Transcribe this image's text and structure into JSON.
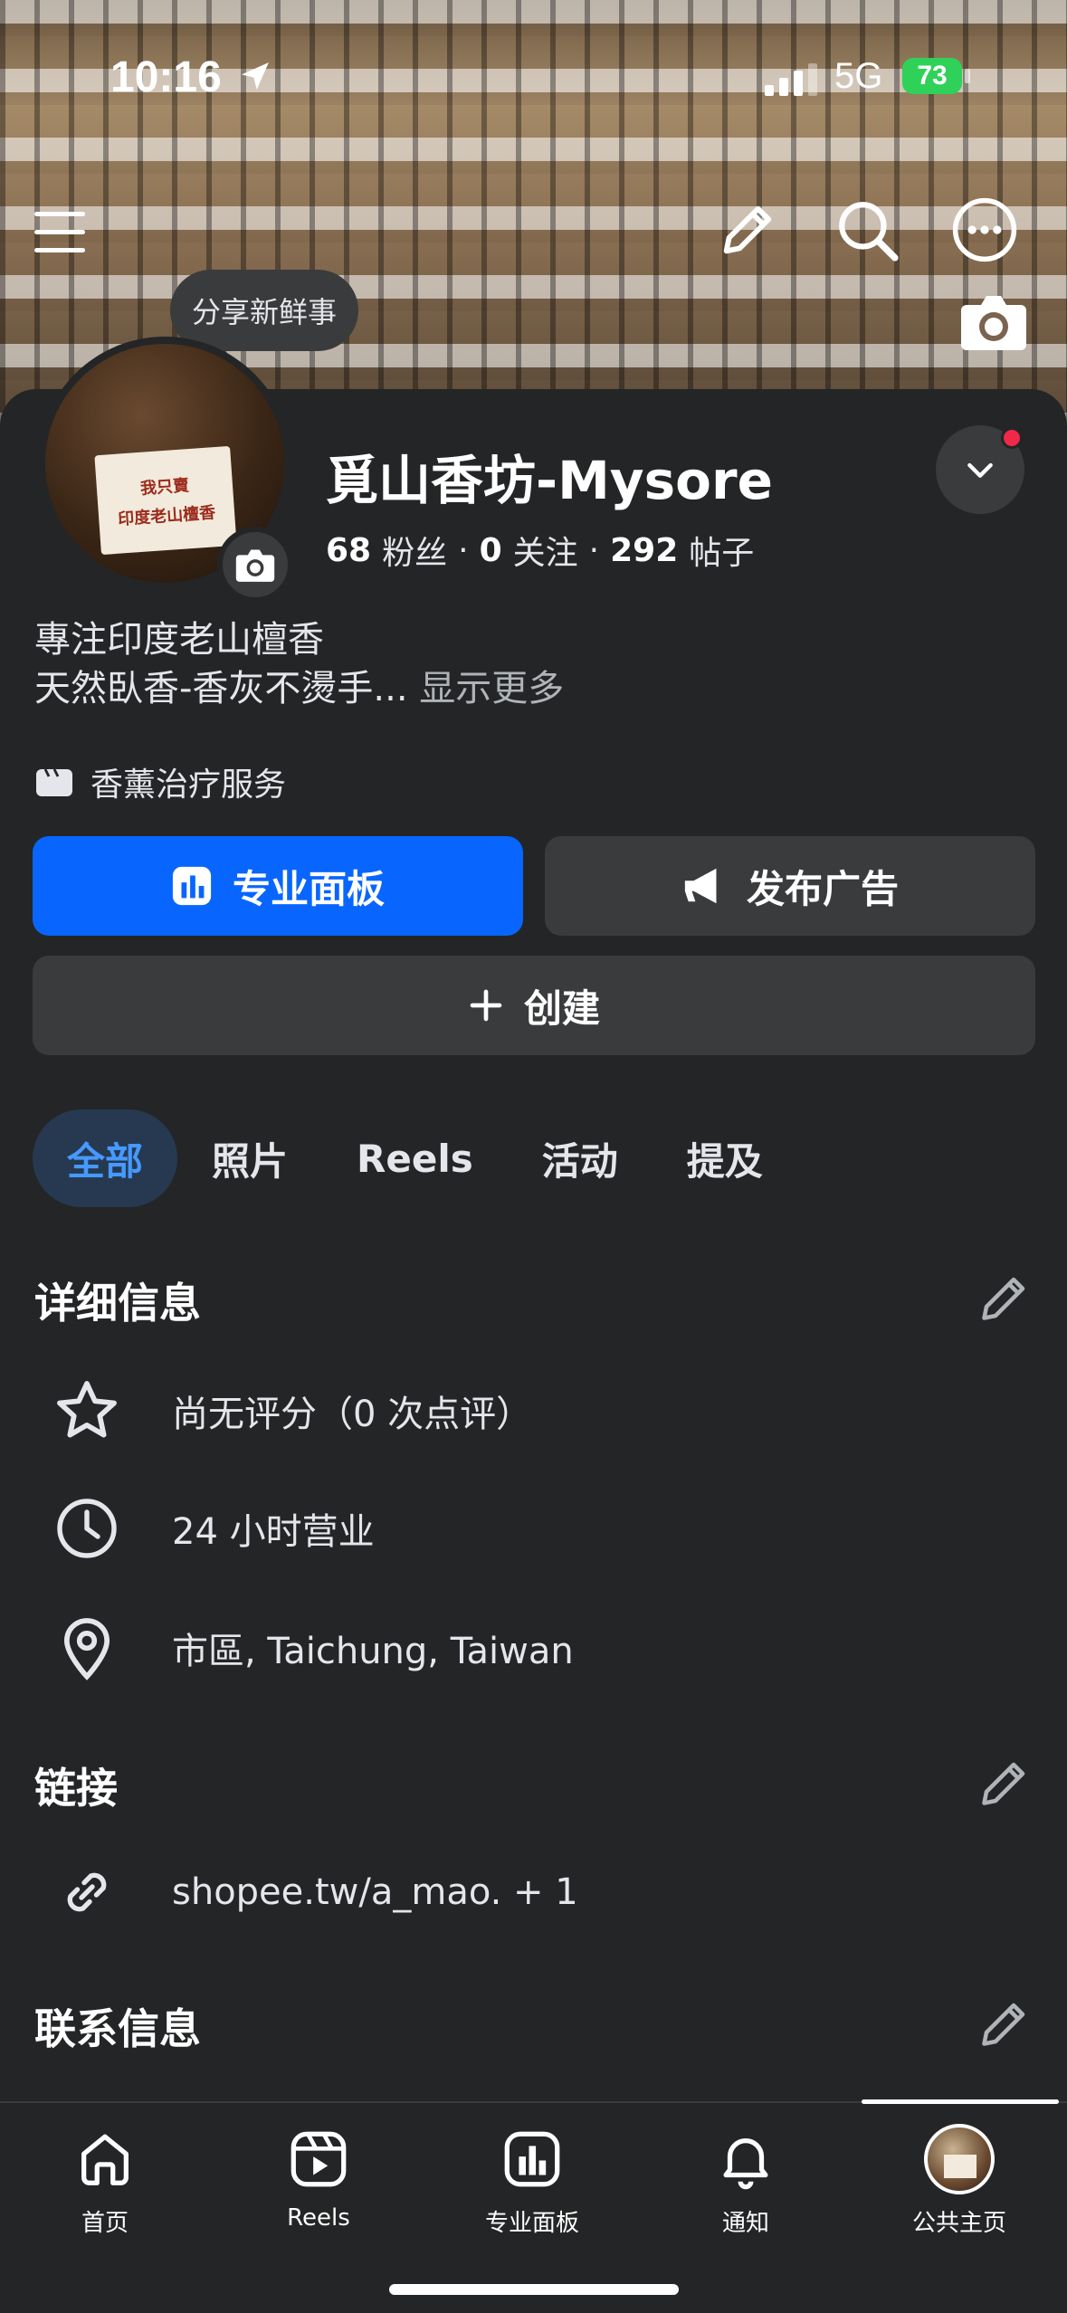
{
  "status_bar": {
    "time": "10:16",
    "network": "5G",
    "battery": "73"
  },
  "share_bubble": "分享新鲜事",
  "profile": {
    "name": "覓山香坊-Mysore",
    "followers_count": "68",
    "followers_label": "粉丝",
    "following_count": "0",
    "following_label": "关注",
    "posts_count": "292",
    "posts_label": "帖子",
    "bio_line1": "專注印度老山檀香",
    "bio_line2": "天然臥香-香灰不燙手...",
    "see_more": "显示更多",
    "category": "香薰治疗服务",
    "avatar_sign_line1": "我只賣",
    "avatar_sign_line2": "印度老山檀香"
  },
  "buttons": {
    "professional_dashboard": "专业面板",
    "promote": "发布广告",
    "create": "创建"
  },
  "tabs": [
    {
      "label": "全部",
      "active": true
    },
    {
      "label": "照片",
      "active": false
    },
    {
      "label": "Reels",
      "active": false
    },
    {
      "label": "活动",
      "active": false
    },
    {
      "label": "提及",
      "active": false
    }
  ],
  "details": {
    "title": "详细信息",
    "rating": "尚无评分（0 次点评）",
    "hours": "24 小时营业",
    "location": "市區, Taichung, Taiwan"
  },
  "links": {
    "title": "链接",
    "url": "shopee.tw/a_mao. + 1"
  },
  "contact": {
    "title": "联系信息"
  },
  "bottom_nav": [
    {
      "label": "首页",
      "icon": "home-icon"
    },
    {
      "label": "Reels",
      "icon": "reels-icon"
    },
    {
      "label": "专业面板",
      "icon": "dashboard-icon"
    },
    {
      "label": "通知",
      "icon": "bell-icon"
    },
    {
      "label": "公共主页",
      "icon": "page-avatar"
    }
  ],
  "colors": {
    "accent": "#0866ff",
    "background": "#242526",
    "surface": "#3a3b3c",
    "notification": "#f02849",
    "battery": "#30d158"
  }
}
